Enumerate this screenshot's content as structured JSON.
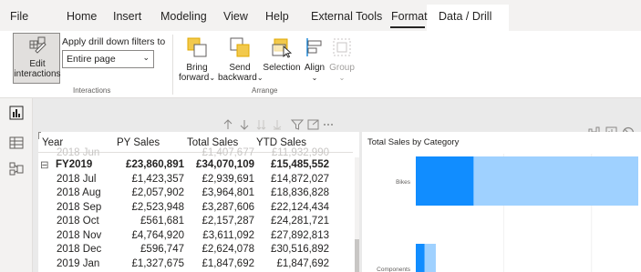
{
  "menu": {
    "items": [
      "File",
      "Home",
      "Insert",
      "Modeling",
      "View",
      "Help",
      "External Tools",
      "Format",
      "Data / Drill"
    ],
    "active": "Format"
  },
  "ribbon": {
    "interactions": {
      "edit_button_line1": "Edit",
      "edit_button_line2": "interactions",
      "apply_label": "Apply drill down filters to",
      "dropdown_value": "Entire page",
      "group_label": "Interactions"
    },
    "arrange": {
      "bring_forward_line1": "Bring",
      "bring_forward_line2": "forward",
      "send_backward_line1": "Send",
      "send_backward_line2": "backward",
      "selection": "Selection",
      "align": "Align",
      "group": "Group",
      "group_label": "Arrange"
    }
  },
  "table": {
    "headers": [
      "Year",
      "PY Sales",
      "Total Sales",
      "YTD Sales"
    ],
    "partial_top_row": {
      "year": "2018 Jun",
      "py": "",
      "total": "£1,407,677",
      "ytd": "£11,932,990"
    },
    "rows": [
      {
        "year": "FY2019",
        "py": "£23,860,891",
        "total": "£34,070,109",
        "ytd": "£15,485,552",
        "expander": "⊟",
        "bold": true
      },
      {
        "year": "2018 Jul",
        "py": "£1,423,357",
        "total": "£2,939,691",
        "ytd": "£14,872,027"
      },
      {
        "year": "2018 Aug",
        "py": "£2,057,902",
        "total": "£3,964,801",
        "ytd": "£18,836,828"
      },
      {
        "year": "2018 Sep",
        "py": "£2,523,948",
        "total": "£3,287,606",
        "ytd": "£22,124,434"
      },
      {
        "year": "2018 Oct",
        "py": "£561,681",
        "total": "£2,157,287",
        "ytd": "£24,281,721"
      },
      {
        "year": "2018 Nov",
        "py": "£4,764,920",
        "total": "£3,611,092",
        "ytd": "£27,892,813"
      },
      {
        "year": "2018 Dec",
        "py": "£596,747",
        "total": "£2,624,078",
        "ytd": "£30,516,892"
      },
      {
        "year": "2019 Jan",
        "py": "£1,327,675",
        "total": "£1,847,692",
        "ytd": "£1,847,692"
      }
    ],
    "toolbar_icons": [
      "arrow-up-icon",
      "arrow-down-icon",
      "double-arrow-down-icon",
      "expand-all-icon",
      "filter-icon",
      "focus-mode-icon",
      "more-options-icon"
    ]
  },
  "chart": {
    "title": "Total Sales by Category",
    "categories": [
      "Bikes",
      "Components"
    ],
    "colors": {
      "dark": "#118dff",
      "light": "#9fd1ff"
    },
    "header_icons": [
      "drill-icon",
      "chart-icon",
      "block-icon"
    ]
  },
  "chart_data": {
    "type": "bar",
    "title": "Total Sales by Category",
    "categories": [
      "Bikes",
      "Components"
    ],
    "series": [
      {
        "values": [
          0.26,
          0.04
        ]
      },
      {
        "values": [
          0.74,
          0.05
        ]
      }
    ]
  }
}
